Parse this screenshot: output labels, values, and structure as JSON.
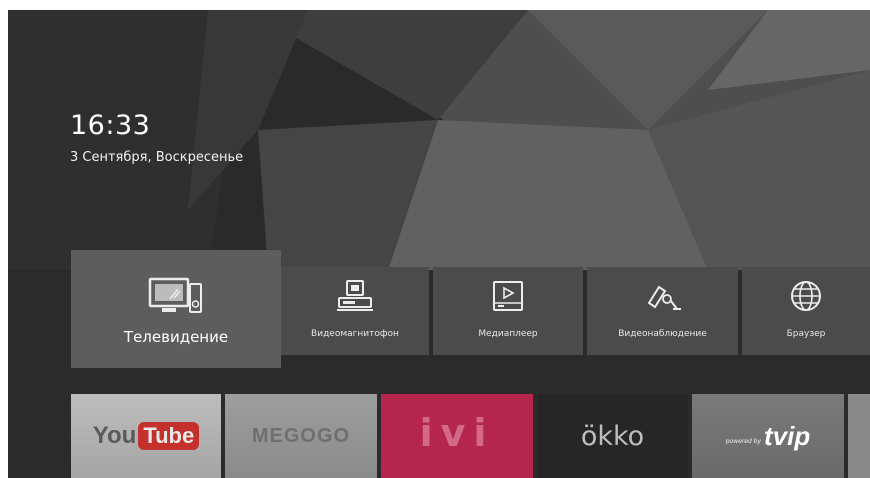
{
  "status": {
    "time": "16:33",
    "date": "3 Сентября, Воскресенье"
  },
  "menu": {
    "items": [
      {
        "label": "Телевидение",
        "icon": "tv-icon"
      },
      {
        "label": "Видеомагнитофон",
        "icon": "vcr-icon"
      },
      {
        "label": "Медиаплеер",
        "icon": "mediaplayer-icon"
      },
      {
        "label": "Видеонаблюдение",
        "icon": "cctv-camera-icon"
      },
      {
        "label": "Браузер",
        "icon": "globe-icon"
      }
    ]
  },
  "apps": {
    "youtube": {
      "you": "You",
      "tube": "Tube"
    },
    "megogo": {
      "label": "MEGOGO"
    },
    "ivi": {
      "label": "ivi"
    },
    "okko": {
      "label": "ökko"
    },
    "tvip": {
      "powered": "powered by",
      "label": "tvip"
    }
  },
  "colors": {
    "background": "#2b2b2b",
    "tile": "#4b4b4b",
    "tile_selected": "#5d5d5d",
    "youtube_red": "#c4302b",
    "ivi_pink": "#b5264f",
    "okko_dark": "#262626"
  }
}
